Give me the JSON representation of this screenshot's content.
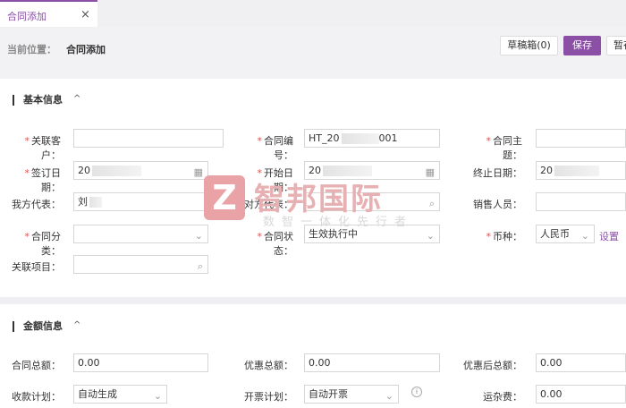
{
  "tab": {
    "label": "合同添加",
    "close": "×"
  },
  "breadcrumb": {
    "label": "当前位置：",
    "value": "合同添加"
  },
  "actions": {
    "draft": "草稿箱(0)",
    "save": "保存",
    "temp": "暂存"
  },
  "basic": {
    "title": "基本信息",
    "chevron": "^",
    "customer_label": "关联客户：",
    "code_label": "合同编号：",
    "code_value": "HT_20",
    "code_suffix": "001",
    "subject_label": "合同主题：",
    "sign_label": "签订日期：",
    "sign_value": "20",
    "start_label": "开始日期：",
    "start_value": "20",
    "end_label": "终止日期：",
    "end_value": "20",
    "rep_label": "我方代表：",
    "rep_value": "刘",
    "other_rep_label": "对方代表：",
    "sales_label": "销售人员：",
    "category_label": "合同分类：",
    "status_label": "合同状态：",
    "status_value": "生效执行中",
    "currency_label": "币种：",
    "currency_value": "人民币",
    "settings_link": "设置",
    "project_label": "关联项目："
  },
  "amount": {
    "title": "金额信息",
    "chevron": "^",
    "total_label": "合同总额：",
    "total_value": "0.00",
    "discount_label": "优惠总额：",
    "discount_value": "0.00",
    "after_label": "优惠后总额：",
    "after_value": "0.00",
    "collect_label": "收款计划：",
    "collect_value": "自动生成",
    "invoice_label": "开票计划：",
    "invoice_value": "自动开票",
    "freight_label": "运杂费：",
    "freight_value": "0.00"
  },
  "watermark": {
    "logo": "Z",
    "name": "智邦国际",
    "sub": "数智一体化先行者"
  },
  "colors": {
    "accent": "#8b4fa6",
    "required": "#d9534f"
  }
}
